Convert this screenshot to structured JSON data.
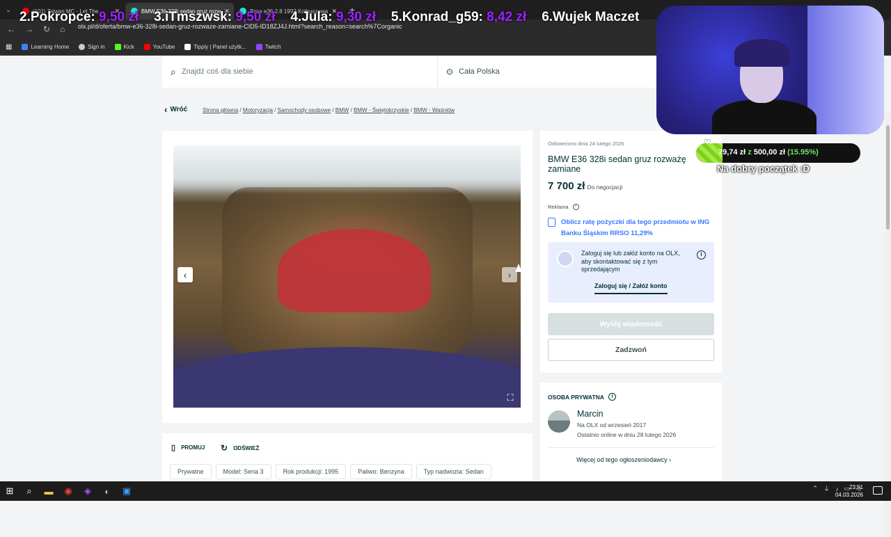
{
  "browser": {
    "tabs": [
      {
        "label": "(101) Taiwan MC - Let The",
        "color": "#ff0000"
      },
      {
        "label": "BMW E36 328i sedan gruz rozw",
        "color": "#23e5db"
      },
      {
        "label": "Bmw e36 2.8 1992 Kolbuszowa",
        "color": "#23e5db"
      }
    ],
    "url": "olx.pl/d/oferta/bmw-e36-328i-sedan-gruz-rozwaze-zamiane-CID5-ID18ZJ4J.html?search_reason=search%7Corganic",
    "bookmarks": [
      {
        "label": "Learning Home",
        "color": "#3b82f6"
      },
      {
        "label": "Sign in",
        "color": "#cccccc"
      },
      {
        "label": "Kick",
        "color": "#53fc18"
      },
      {
        "label": "YouTube",
        "color": "#ff0000"
      },
      {
        "label": "Tipply | Panel użytk...",
        "color": "#ffffff"
      },
      {
        "label": "Twitch",
        "color": "#9146ff"
      }
    ]
  },
  "overlay": {
    "ranking": [
      {
        "label": "2.Pokropce:",
        "amount": "9,50 zł"
      },
      {
        "label": "3.iTmszwsk:",
        "amount": "9,50 zł"
      },
      {
        "label": "4.Jula:",
        "amount": "9,30 zł"
      },
      {
        "label": "5.Konrad_g59:",
        "amount": "8,42 zł"
      },
      {
        "label": "6.Wujek Maczet",
        "amount": ""
      }
    ],
    "goal": {
      "current": "79,74 zł",
      "z": "z",
      "target": "500,00 zł",
      "percent": "(15.95%)",
      "fraction": 0.1595,
      "caption": "Na dobry początek :D"
    }
  },
  "search": {
    "placeholder": "Znajdź coś dla siebie",
    "location": "Cała Polska"
  },
  "nav": {
    "back": "Wróć",
    "breadcrumbs": [
      "Strona główna",
      "Motoryzacja",
      "Samochody osobowe",
      "BMW",
      "BMW - Świętokrzyskie",
      "BMW - Waśniów"
    ]
  },
  "listing": {
    "refreshed": "Odświeżono dnia 24 lutego 2026",
    "title": "BMW E36 328i sedan gruz rozważę zamiane",
    "price": "7 700 zł",
    "negotiable": "Do negocjacji",
    "ad_label": "Reklama",
    "loan_text": "Oblicz ratę pożyczki dla tego przedmiotu w ING Banku Śląskim RRSO 11,29%",
    "login_text": "Zaloguj się lub załóż konto na OLX, aby skontaktować się z tym sprzedającym",
    "login_link": "Zaloguj się / Załóż konto",
    "message_button": "Wyślij wiadomość",
    "call_button": "Zadzwoń",
    "promote": "PROMUJ",
    "refresh": "ODŚWIEŻ",
    "params": [
      "Prywatne",
      "Model: Seria 3",
      "Rok produkcji: 1995",
      "Paliwo: Benzyna",
      "Typ nadwozia: Sedan"
    ]
  },
  "seller": {
    "kind": "OSOBA PRYWATNA",
    "name": "Marcin",
    "since": "Na OLX od wrzesień 2017",
    "online": "Ostatnio online w dniu 28 lutego 2026",
    "more": "Więcej od tego ogłoszeniodawcy"
  },
  "taskbar": {
    "time": "23:51",
    "date": "04.03.2026"
  }
}
